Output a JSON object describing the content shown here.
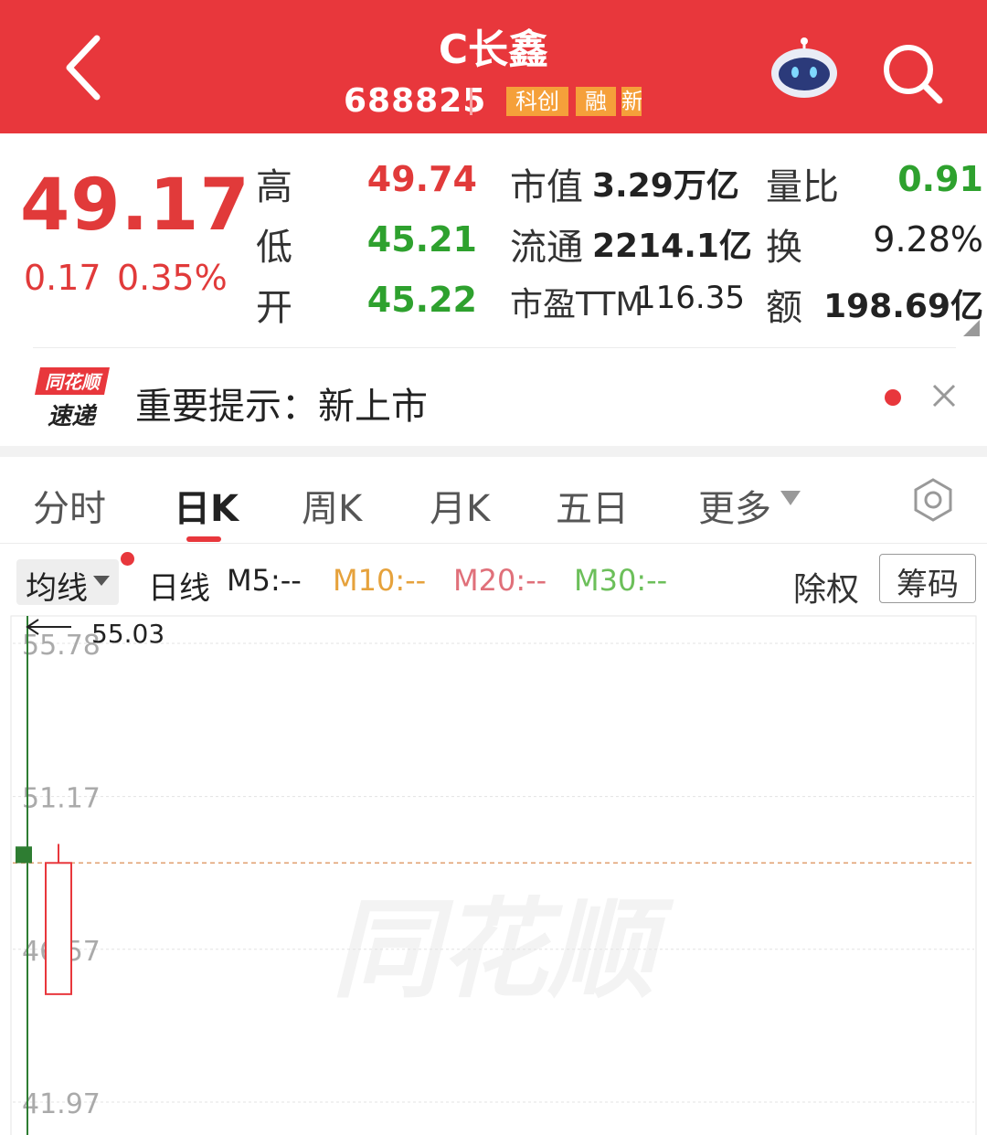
{
  "header": {
    "title": "C长鑫",
    "code": "688825",
    "tags": [
      "科创",
      "融",
      "新"
    ],
    "colors": {
      "bar": "#e8373c",
      "tag": "#f5a03a"
    },
    "icons": {
      "back": "back-arrow-icon",
      "assistant": "robot-assistant-icon",
      "search": "search-icon"
    }
  },
  "quote": {
    "price": "49.17",
    "change": "0.17",
    "change_pct": "0.35%",
    "rows": [
      {
        "l1": "高",
        "v1": "49.74",
        "l2": "市值",
        "v2": "3.29万亿",
        "l3": "量比",
        "v3": "0.91"
      },
      {
        "l1": "低",
        "v1": "45.21",
        "l2": "流通",
        "v2": "2214.1亿",
        "l3": "换",
        "v3": "9.28%"
      },
      {
        "l1": "开",
        "v1": "45.22",
        "l2": "市盈TTM",
        "v2": "116.35",
        "l3": "额",
        "v3": "198.69亿"
      }
    ]
  },
  "notice": {
    "logo_line1": "同花顺",
    "logo_line2": "速递",
    "text": "重要提示：新上市"
  },
  "tabs": [
    "分时",
    "日K",
    "周K",
    "月K",
    "五日",
    "更多"
  ],
  "active_tab": "日K",
  "indicators": {
    "selector": "均线",
    "period": "日线",
    "m5": "M5:--",
    "m10": "M10:--",
    "m20": "M20:--",
    "m30": "M30:--",
    "ex_rights": "除权",
    "chips": "筹码",
    "colors": {
      "m5": "#222222",
      "m10": "#e6a23c",
      "m20": "#e0707a",
      "m30": "#6cbf5a"
    }
  },
  "chart_data": {
    "type": "candlestick",
    "y_ticks": [
      "55.78",
      "51.17",
      "46.57",
      "41.97"
    ],
    "ylim": [
      41.97,
      55.78
    ],
    "max_marker": "55.03",
    "last_price": 49.17,
    "candles": [
      {
        "open": 49.5,
        "high": 55.03,
        "low": 41.5,
        "close": 49.0,
        "color": "#2e7d32"
      },
      {
        "open": 45.22,
        "high": 49.74,
        "low": 45.21,
        "close": 49.17,
        "color": "#e8373c"
      }
    ],
    "watermark": "同花顺"
  }
}
